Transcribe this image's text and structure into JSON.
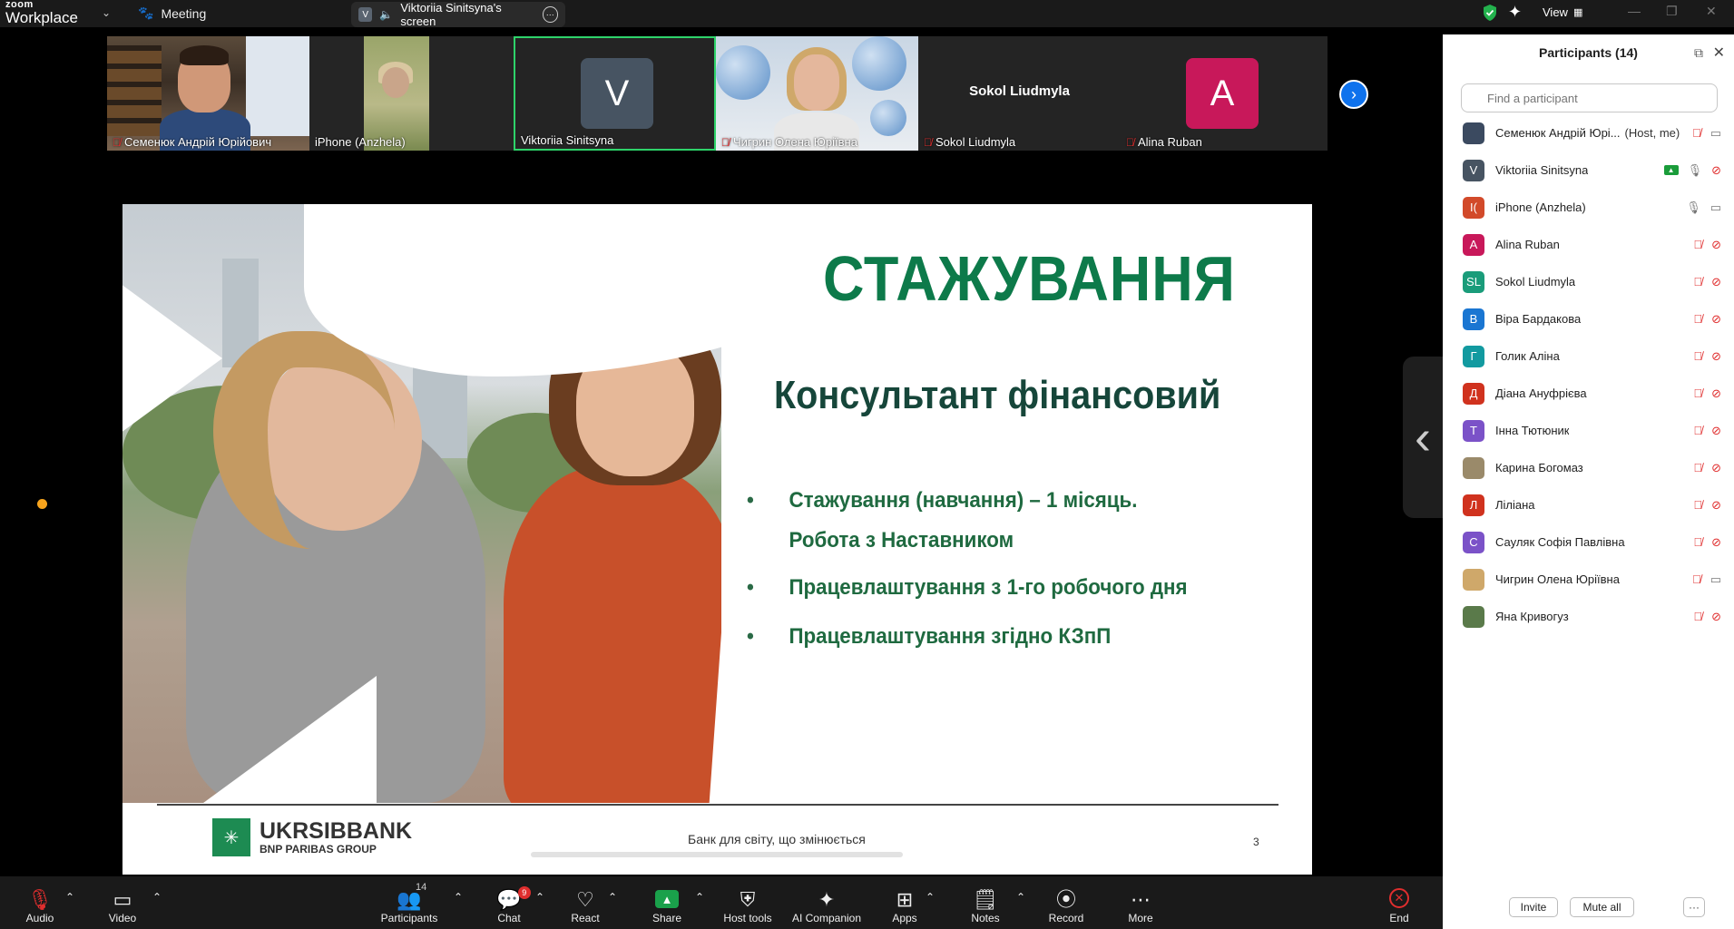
{
  "app": {
    "logo_top": "zoom",
    "logo_bottom": "Workplace",
    "meeting_label": "Meeting",
    "screen_badge": "V",
    "screen_label": "Viktoriia Sinitsyna's screen",
    "view_label": "View"
  },
  "colors": {
    "accent_green": "#2ed36a",
    "brand_blue": "#0e72ed",
    "mute_red": "#e02e2e",
    "slide_green": "#0d7a4a"
  },
  "strip": {
    "tiles": [
      {
        "name": "Семенюк Андрій Юрійович",
        "muted": true
      },
      {
        "name": "iPhone (Anzhela)",
        "muted": false
      },
      {
        "name": "Viktoriia Sinitsyna",
        "muted": false,
        "avatar": "V"
      },
      {
        "name": "Чигрин Олена Юріївна",
        "muted": true
      },
      {
        "name": "Sokol Liudmyla",
        "muted": true,
        "big": "Sokol Liudmyla"
      },
      {
        "name": "Alina Ruban",
        "muted": true,
        "avatar": "A"
      }
    ]
  },
  "slide": {
    "title": "СТАЖУВАННЯ",
    "subtitle": "Консультант фінансовий",
    "bullet1_line1": "Стажування (навчання) – 1 місяць.",
    "bullet1_line2": "Робота з Наставником",
    "bullet2": "Працевлаштування з 1-го робочого дня",
    "bullet3": "Працевлаштування згідно КЗпП",
    "logo_main": "UKRSIBBANK",
    "logo_sub": "BNP PARIBAS GROUP",
    "tagline": "Банк для світу, що змінюється",
    "page_number": "3"
  },
  "panel": {
    "title": "Participants (14)",
    "search_placeholder": "Find a participant",
    "invite": "Invite",
    "mute_all": "Mute all",
    "more": "···",
    "participants": [
      {
        "name": "Семенюк Андрій Юрі...",
        "status": "(Host, me)",
        "initial": "",
        "color": "#3b4a60"
      },
      {
        "name": "Viktoriia Sinitsyna",
        "status": "",
        "initial": "V",
        "color": "#475462"
      },
      {
        "name": "iPhone (Anzhela)",
        "status": "",
        "initial": "I(",
        "color": "#d24a2a"
      },
      {
        "name": "Alina Ruban",
        "status": "",
        "initial": "A",
        "color": "#c8185a"
      },
      {
        "name": "Sokol Liudmyla",
        "status": "",
        "initial": "SL",
        "color": "#1a9c7a"
      },
      {
        "name": "Віра Бардакова",
        "status": "",
        "initial": "В",
        "color": "#1a76d2"
      },
      {
        "name": "Голик Аліна",
        "status": "",
        "initial": "Г",
        "color": "#129aa0"
      },
      {
        "name": "Діана Ануфрієва",
        "status": "",
        "initial": "Д",
        "color": "#d0321e"
      },
      {
        "name": "Інна Тютюник",
        "status": "",
        "initial": "Т",
        "color": "#7b52c8"
      },
      {
        "name": "Карина Богомаз",
        "status": "",
        "initial": "",
        "color": "#9a8a6a"
      },
      {
        "name": "Ліліана",
        "status": "",
        "initial": "Л",
        "color": "#d0321e"
      },
      {
        "name": "Сауляк Софія Павлівна",
        "status": "",
        "initial": "С",
        "color": "#7b52c8"
      },
      {
        "name": "Чигрин Олена Юріївна",
        "status": "",
        "initial": "",
        "color": "#cfa86a"
      },
      {
        "name": "Яна Кривогуз",
        "status": "",
        "initial": "",
        "color": "#5a7a4a"
      }
    ]
  },
  "toolbar": {
    "audio": "Audio",
    "video": "Video",
    "participants": "Participants",
    "participants_count": "14",
    "chat": "Chat",
    "chat_badge": "9",
    "react": "React",
    "share": "Share",
    "host_tools": "Host tools",
    "ai_companion": "AI Companion",
    "apps": "Apps",
    "notes": "Notes",
    "record": "Record",
    "more": "More",
    "end": "End"
  }
}
